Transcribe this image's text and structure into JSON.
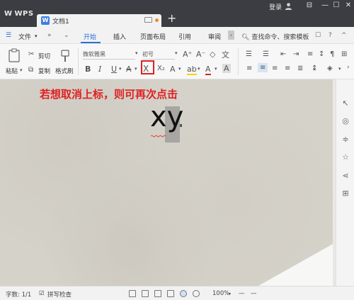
{
  "titlebar": {
    "app_name": "WPS",
    "doc_tab": "文档1",
    "new_tab": "+",
    "login": "登录",
    "window_controls": {
      "settings": "⊟",
      "minimize": "—",
      "maximize": "☐",
      "close": "✕"
    }
  },
  "menubar": {
    "file_label": "文件",
    "items": [
      "开始",
      "插入",
      "页面布局",
      "引用",
      "审阅"
    ],
    "active_index": 0,
    "search_placeholder": "查找命令、搜索模板"
  },
  "ribbon": {
    "paste": "粘贴",
    "cut": "剪切",
    "copy": "复制",
    "format_painter": "格式刷",
    "font_name": "微软雅黑",
    "font_size": "初号",
    "bold": "B",
    "italic": "I",
    "underline": "U",
    "highlighted_tool": "subscript-remove-icon"
  },
  "document": {
    "annotation": "若想取消上标，则可再次点击",
    "text": "xy"
  },
  "statusbar": {
    "word_count": "字数: 1/1",
    "spell_check": "拼写检查",
    "zoom": "100%",
    "zoom_minus": "—",
    "zoom_plus": "—"
  },
  "colors": {
    "titlebar_bg": "#3b3d42",
    "accent": "#2b6fd6",
    "annotation_red": "#e02020"
  }
}
